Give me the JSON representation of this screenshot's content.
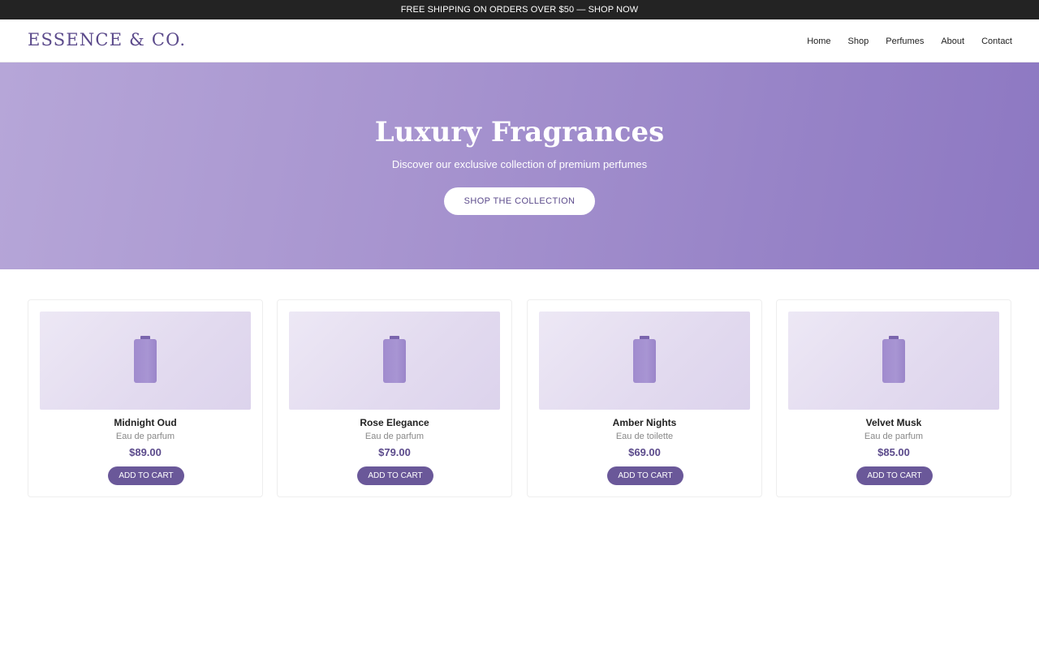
{
  "announcement": {
    "text": "FREE SHIPPING ON ORDERS OVER $50 — SHOP NOW"
  },
  "header": {
    "logo": "ESSENCE & CO.",
    "nav": [
      "Home",
      "Shop",
      "Perfumes",
      "About",
      "Contact"
    ]
  },
  "hero": {
    "title": "Luxury Fragrances",
    "subtitle": "Discover our exclusive collection of premium perfumes",
    "cta_label": "SHOP THE COLLECTION"
  },
  "products": [
    {
      "name": "Midnight Oud",
      "type": "Eau de parfum",
      "price": "$89.00",
      "button_label": "ADD TO CART",
      "icon": "perfume-bottle-icon"
    },
    {
      "name": "Rose Elegance",
      "type": "Eau de parfum",
      "price": "$79.00",
      "button_label": "ADD TO CART",
      "icon": "perfume-bottle-icon"
    },
    {
      "name": "Amber Nights",
      "type": "Eau de toilette",
      "price": "$69.00",
      "button_label": "ADD TO CART",
      "icon": "perfume-bottle-icon"
    },
    {
      "name": "Velvet Musk",
      "type": "Eau de parfum",
      "price": "$85.00",
      "button_label": "ADD TO CART",
      "icon": "perfume-bottle-icon"
    }
  ],
  "colors": {
    "brand": "#5b4a8b",
    "button": "#6a5899",
    "hero_start": "#b6a6d8",
    "hero_end": "#8d78c2",
    "announcement_bg": "#232323"
  }
}
